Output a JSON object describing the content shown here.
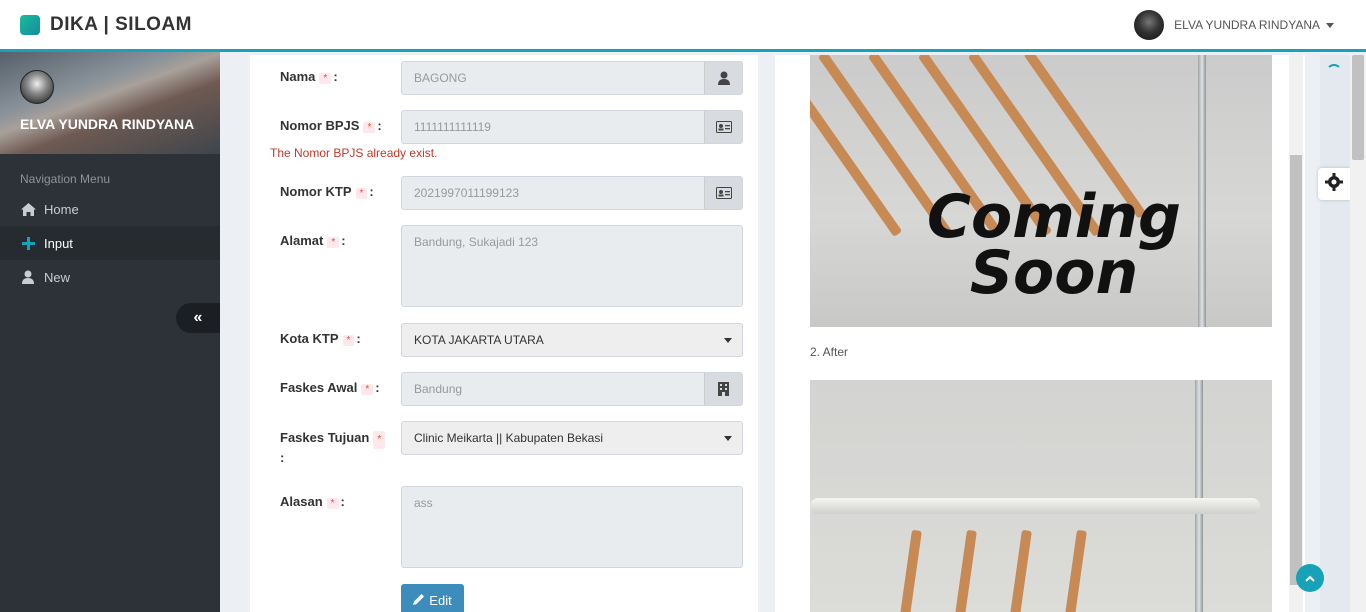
{
  "header": {
    "brand": "DIKA | SILOAM",
    "user_name": "ELVA YUNDRA RINDYANA"
  },
  "sidebar": {
    "profile_name": "ELVA YUNDRA RINDYANA",
    "nav_header": "Navigation Menu",
    "items": [
      {
        "label": "Home",
        "icon": "home-icon"
      },
      {
        "label": "Input",
        "icon": "plus-icon",
        "active": true
      },
      {
        "label": "New",
        "icon": "user-icon"
      }
    ]
  },
  "form": {
    "required_mark": "*",
    "nama": {
      "label": "Nama",
      "value": "BAGONG"
    },
    "bpjs": {
      "label": "Nomor BPJS",
      "value": "1111111111119",
      "error": "The Nomor BPJS already exist."
    },
    "ktp": {
      "label": "Nomor KTP",
      "value": "2021997011199123"
    },
    "alamat": {
      "label": "Alamat",
      "value": "Bandung, Sukajadi 123"
    },
    "kota_ktp": {
      "label": "Kota KTP",
      "value": "KOTA JAKARTA UTARA"
    },
    "faskes_awal": {
      "label": "Faskes Awal",
      "value": "Bandung"
    },
    "faskes_tujuan": {
      "label": "Faskes Tujuan",
      "value": "Clinic Meikarta || Kabupaten Bekasi"
    },
    "alasan": {
      "label": "Alasan",
      "value": "ass"
    },
    "edit_label": "Edit",
    "colon": ":"
  },
  "images": {
    "overlay_text": "Coming Soon",
    "caption_after": "2. After"
  },
  "colors": {
    "accent": "#17a2b8",
    "sidebar": "#2c3238",
    "edit_button": "#3c8dbc",
    "error": "#c0392b"
  }
}
